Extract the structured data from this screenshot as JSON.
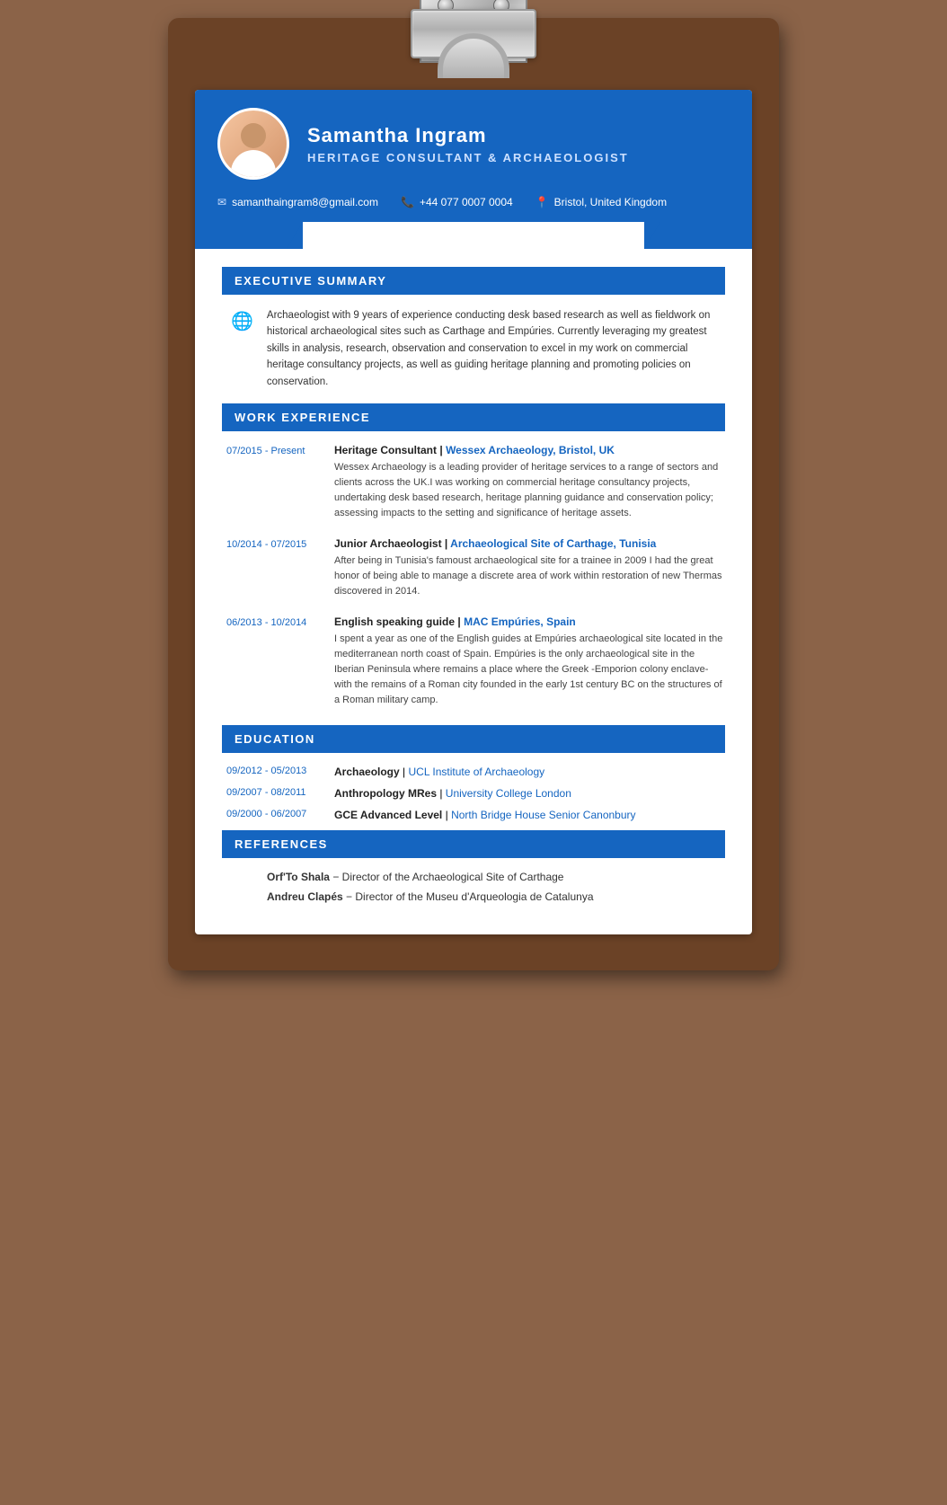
{
  "header": {
    "name": "Samantha Ingram",
    "title": "Heritage Consultant & Archaeologist",
    "email": "samanthaingram8@gmail.com",
    "phone": "+44 077 0007 0004",
    "location": "Bristol, United Kingdom"
  },
  "executive_summary": {
    "section_label": "EXECUTIVE SUMMARY",
    "text": "Archaeologist with 9 years of experience conducting desk based research as well as fieldwork on historical archaeological sites such as Carthage and Empúries. Currently leveraging my greatest skills in analysis, research, observation and conservation to excel in my work on commercial heritage consultancy projects, as well as guiding heritage planning and promoting policies on conservation."
  },
  "work_experience": {
    "section_label": "WORK EXPERIENCE",
    "jobs": [
      {
        "date": "07/2015 - Present",
        "title": "Heritage Consultant",
        "company": "Wessex Archaeology, Bristol, UK",
        "description": "Wessex Archaeology is a leading provider of heritage services to a range of sectors and clients across the UK.I was working on commercial heritage consultancy projects, undertaking desk based research, heritage planning guidance and conservation policy; assessing impacts to the setting and significance of heritage assets."
      },
      {
        "date": "10/2014 - 07/2015",
        "title": "Junior Archaeologist",
        "company": "Archaeological Site of Carthage, Tunisia",
        "description": "After being in Tunisia's famoust archaeological site for a trainee in 2009 I had the great honor of being able to manage a discrete area of work within restoration of new Thermas discovered in 2014."
      },
      {
        "date": "06/2013 - 10/2014",
        "title": "English speaking guide",
        "company": "MAC Empúries, Spain",
        "description": "I spent a year as one of the English guides at Empúries archaeological site located in the mediterranean north coast of Spain. Empúries is the only archaeological site in the Iberian Peninsula where remains a place where the Greek -Emporion colony enclave- with the remains of a Roman city founded in the early 1st century BC on the structures of a Roman military camp."
      }
    ]
  },
  "education": {
    "section_label": "EDUCATION",
    "items": [
      {
        "date": "09/2012 - 05/2013",
        "degree": "Archaeology",
        "school": "UCL Institute of Archaeology"
      },
      {
        "date": "09/2007 - 08/2011",
        "degree": "Anthropology MRes",
        "school": "University College London"
      },
      {
        "date": "09/2000 - 06/2007",
        "degree": "GCE Advanced Level",
        "school": "North Bridge House Senior Canonbury"
      }
    ]
  },
  "references": {
    "section_label": "REFERENCES",
    "items": [
      {
        "name": "Orf'To Shala",
        "role": "Director of the Archaeological Site of Carthage"
      },
      {
        "name": "Andreu Clapés",
        "role": "Director of the Museu d'Arqueologia de Catalunya"
      }
    ]
  }
}
